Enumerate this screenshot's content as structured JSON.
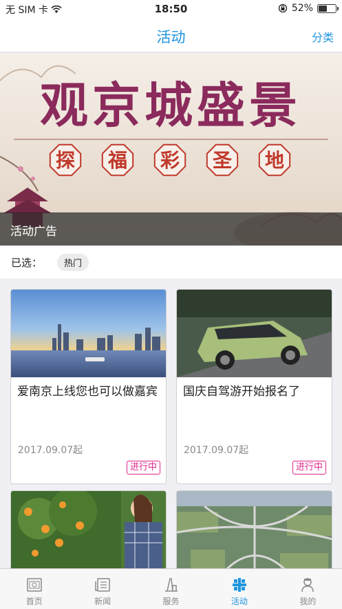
{
  "status": {
    "carrier": "无 SIM 卡",
    "time": "18:50",
    "battery": "52%",
    "battery_level": 0.52
  },
  "nav": {
    "title": "活动",
    "action": "分类"
  },
  "banner": {
    "headline": "观京城盛景",
    "subline": [
      "探",
      "福",
      "彩",
      "圣",
      "地"
    ],
    "caption": "活动广告"
  },
  "filter": {
    "label": "已选：",
    "chip": "热门"
  },
  "cards": [
    {
      "title": "爱南京上线您也可以做嘉宾",
      "date": "2017.09.07起",
      "status": "进行中"
    },
    {
      "title": "国庆自驾游开始报名了",
      "date": "2017.09.07起",
      "status": "进行中"
    },
    {
      "title": "",
      "date": "",
      "status": ""
    },
    {
      "title": "",
      "date": "",
      "status": ""
    }
  ],
  "tabs": [
    {
      "label": "首页",
      "icon": "home-icon"
    },
    {
      "label": "新闻",
      "icon": "news-icon"
    },
    {
      "label": "服务",
      "icon": "service-icon"
    },
    {
      "label": "活动",
      "icon": "activity-icon"
    },
    {
      "label": "我的",
      "icon": "profile-icon"
    }
  ],
  "colors": {
    "accent": "#1e95e0",
    "status_tag": "#e0268b"
  }
}
